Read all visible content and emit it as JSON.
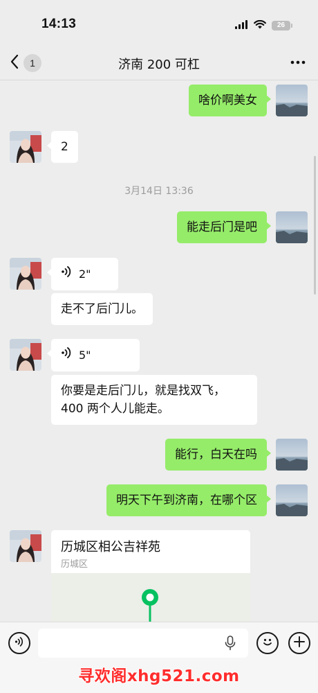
{
  "status_bar": {
    "time": "14:13",
    "battery_level": "26",
    "icons": [
      "signal-icon",
      "wifi-icon",
      "battery-icon"
    ]
  },
  "nav": {
    "unread_count": "1",
    "title": "济南 200 可杠",
    "icons": [
      "back-chevron-icon",
      "more-dots-icon"
    ]
  },
  "messages": [
    {
      "sender": "me",
      "type": "text",
      "text": "啥价啊美女"
    },
    {
      "sender": "them",
      "type": "text",
      "text": "2"
    },
    {
      "type": "timestamp",
      "text": "3月14日 13:36"
    },
    {
      "sender": "me",
      "type": "text",
      "text": "能走后门是吧"
    },
    {
      "sender": "them",
      "type": "voice",
      "duration": "2\""
    },
    {
      "sender": "them",
      "type": "text",
      "text": "走不了后门儿。"
    },
    {
      "sender": "them",
      "type": "voice",
      "duration": "5\""
    },
    {
      "sender": "them",
      "type": "text",
      "line1": "你要是走后门儿，就是找双飞，",
      "line2": "400 两个人儿能走。"
    },
    {
      "sender": "me",
      "type": "text",
      "text": "能行，白天在吗"
    },
    {
      "sender": "me",
      "type": "text",
      "text": "明天下午到济南，在哪个区"
    },
    {
      "sender": "them",
      "type": "location",
      "title": "历城区相公吉祥苑",
      "address": "历城区"
    }
  ],
  "input_bar": {
    "placeholder": "",
    "value": "",
    "icons": [
      "voice-input-icon",
      "mic-icon",
      "emoji-icon",
      "plus-icon"
    ]
  },
  "watermark": "寻欢阁xhg521.com",
  "colors": {
    "background": "#ededed",
    "my_bubble": "#95ec69",
    "their_bubble": "#ffffff",
    "timestamp_text": "#9b9b9b",
    "map_pin": "#07c160",
    "watermark": "#ff2d2d"
  }
}
